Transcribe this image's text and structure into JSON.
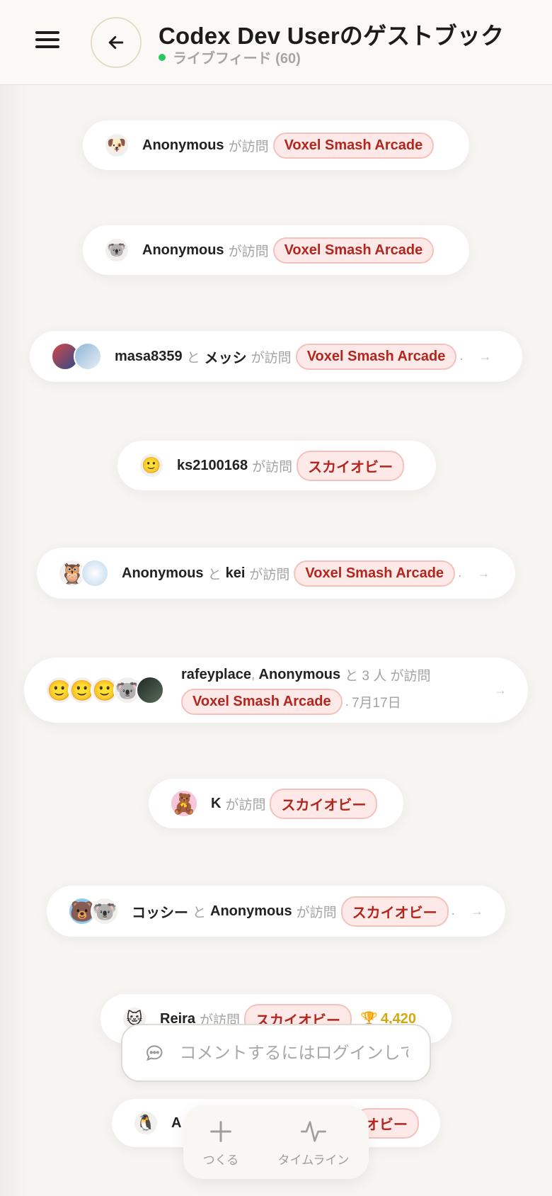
{
  "header": {
    "title": "Codex Dev Userのゲストブック",
    "live_label": "ライブフィード (60)"
  },
  "feed": [
    {
      "names": [
        "Anonymous"
      ],
      "verb": "が訪問",
      "game": "Voxel Smash Arcade",
      "avatars": [
        "dog-avatar"
      ]
    },
    {
      "names": [
        "Anonymous"
      ],
      "verb": "が訪問",
      "game": "Voxel Smash Arcade",
      "avatars": [
        "koala-avatar"
      ]
    },
    {
      "names": [
        "masa8359",
        "メッシ"
      ],
      "joiner": "と",
      "verb": "が訪問",
      "game": "Voxel Smash Arcade",
      "avatars": [
        "photo-avatar",
        "photo-avatar"
      ]
    },
    {
      "names": [
        "ks2100168"
      ],
      "verb": "が訪問",
      "game": "スカイオビー",
      "avatars": [
        "smile-avatar"
      ]
    },
    {
      "names": [
        "Anonymous",
        "kei"
      ],
      "joiner": "と",
      "verb": "が訪問",
      "game": "Voxel Smash Arcade",
      "avatars": [
        "owl-avatar",
        "photo-avatar"
      ]
    },
    {
      "names": [
        "rafeyplace",
        "Anonymous"
      ],
      "extra": "と 3 人 が訪問",
      "game": "Voxel Smash Arcade",
      "date": "7月17日",
      "avatars": [
        "smile-avatar",
        "smile-avatar",
        "smile-avatar",
        "koala-avatar",
        "photo-avatar"
      ]
    },
    {
      "names": [
        "K"
      ],
      "verb": "が訪問",
      "game": "スカイオビー",
      "avatars": [
        "pink-bear-avatar"
      ]
    },
    {
      "names": [
        "コッシー",
        "Anonymous"
      ],
      "joiner": "と",
      "verb": "が訪問",
      "game": "スカイオビー",
      "avatars": [
        "blue-character-avatar",
        "koala-avatar"
      ]
    },
    {
      "names": [
        "Reira"
      ],
      "verb": "が訪問",
      "game": "スカイオビー",
      "score": "4,420",
      "avatars": [
        "cat-avatar"
      ]
    },
    {
      "names": [
        "A"
      ],
      "game": "オビー",
      "avatars": [
        "penguin-avatar"
      ]
    }
  ],
  "separator_dot": ".",
  "comment": {
    "placeholder": "コメントするにはログインしてください"
  },
  "nav": {
    "create_label": "つくる",
    "timeline_label": "タイムライン"
  },
  "icons": {
    "menu": "hamburger-icon",
    "back": "arrow-left-icon",
    "chat": "chat-bubble-icon",
    "arrow": "arrow-right-icon",
    "trophy": "trophy-icon",
    "plus": "plus-icon",
    "pulse": "pulse-icon"
  },
  "colors": {
    "live": "#2ac764",
    "tag_bg": "#fde9e7",
    "tag_text": "#b3261e",
    "score": "#d4a80f"
  }
}
